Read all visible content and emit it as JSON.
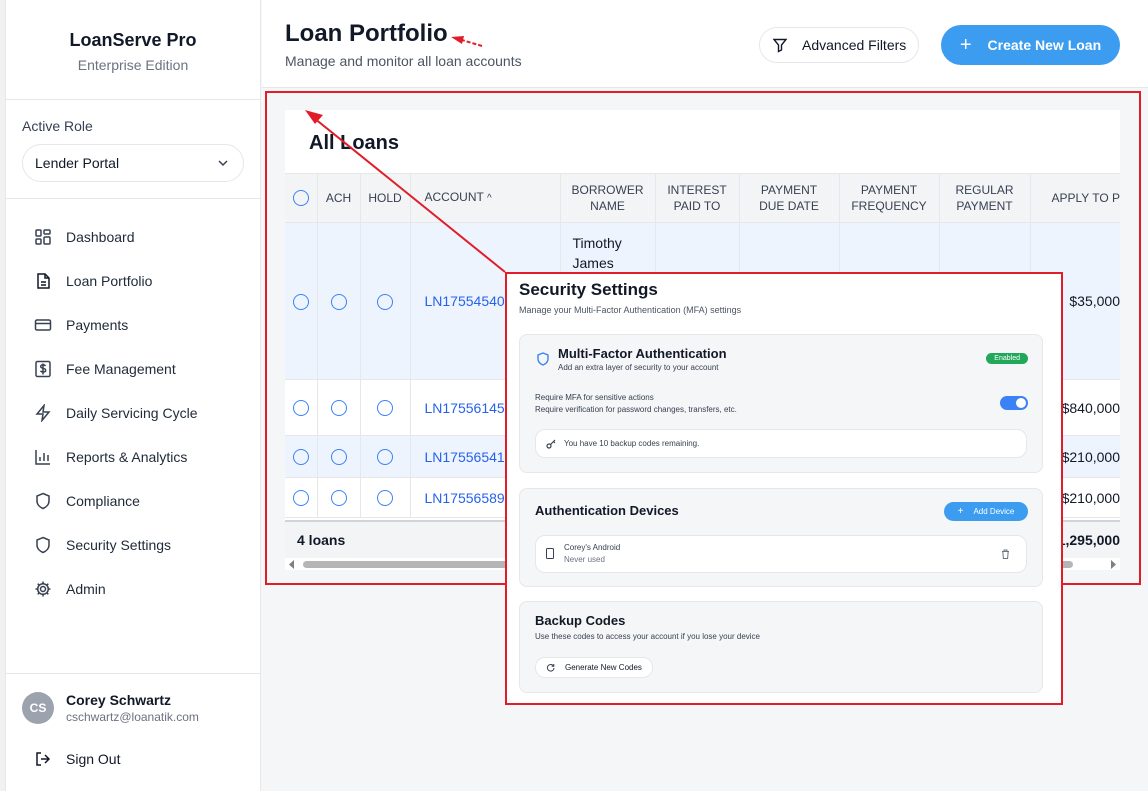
{
  "brand": {
    "name": "LoanServe Pro",
    "edition": "Enterprise Edition"
  },
  "role": {
    "label": "Active Role",
    "value": "Lender Portal"
  },
  "nav": [
    {
      "label": "Dashboard",
      "icon": "dashboard-icon"
    },
    {
      "label": "Loan Portfolio",
      "icon": "document-icon"
    },
    {
      "label": "Payments",
      "icon": "credit-card-icon"
    },
    {
      "label": "Fee Management",
      "icon": "dollar-icon"
    },
    {
      "label": "Daily Servicing Cycle",
      "icon": "lightning-icon"
    },
    {
      "label": "Reports & Analytics",
      "icon": "bar-chart-icon"
    },
    {
      "label": "Compliance",
      "icon": "shield-icon"
    },
    {
      "label": "Security Settings",
      "icon": "shield-icon"
    },
    {
      "label": "Admin",
      "icon": "gear-icon"
    }
  ],
  "user": {
    "initials": "CS",
    "name": "Corey Schwartz",
    "email": "cschwartz@loanatik.com",
    "signout": "Sign Out"
  },
  "header": {
    "title": "Loan Portfolio",
    "subtitle": "Manage and monitor all loan accounts",
    "filters_label": "Advanced Filters",
    "create_label": "Create New Loan"
  },
  "loans": {
    "title": "All Loans",
    "columns": [
      "ACH",
      "HOLD",
      "ACCOUNT",
      "BORROWER NAME",
      "INTEREST PAID TO",
      "PAYMENT DUE DATE",
      "PAYMENT FREQUENCY",
      "REGULAR PAYMENT",
      "APPLY TO P"
    ],
    "column_lines": {
      "borrower": [
        "BORROWER",
        "NAME"
      ],
      "interest": [
        "INTEREST",
        "PAID TO"
      ],
      "due": [
        "PAYMENT",
        "DUE DATE"
      ],
      "freq": [
        "PAYMENT",
        "FREQUENCY"
      ],
      "regular": [
        "REGULAR",
        "PAYMENT"
      ]
    },
    "sort_indicator": "^",
    "rows": [
      {
        "account": "LN17554540",
        "borrower_1": "Timothy",
        "borrower_2": "James",
        "amount": "$35,000"
      },
      {
        "account": "LN17556145",
        "borrower_1": "",
        "borrower_2": "",
        "amount": "$840,000"
      },
      {
        "account": "LN17556541",
        "borrower_1": "",
        "borrower_2": "",
        "amount": "$210,000"
      },
      {
        "account": "LN17556589",
        "borrower_1": "",
        "borrower_2": "",
        "amount": "$210,000"
      }
    ],
    "footer_count": "4 loans",
    "footer_total": "1,295,000"
  },
  "security": {
    "title": "Security Settings",
    "subtitle": "Manage your Multi-Factor Authentication (MFA) settings",
    "mfa": {
      "title": "Multi-Factor Authentication",
      "desc": "Add an extra layer of security to your account",
      "status": "Enabled",
      "require_title": "Require MFA for sensitive actions",
      "require_desc": "Require verification for password changes, transfers, etc.",
      "backup_note": "You have 10 backup codes remaining."
    },
    "devices": {
      "title": "Authentication Devices",
      "add_label": "Add Device",
      "device_name": "Corey's Android",
      "device_status": "Never used"
    },
    "backup": {
      "title": "Backup Codes",
      "desc": "Use these codes to access your account if you lose your device",
      "generate_label": "Generate New Codes"
    }
  },
  "colors": {
    "accent": "#3b9cf0",
    "annotation": "#e11d2a",
    "enabled": "#22a85a",
    "link": "#2563eb"
  }
}
